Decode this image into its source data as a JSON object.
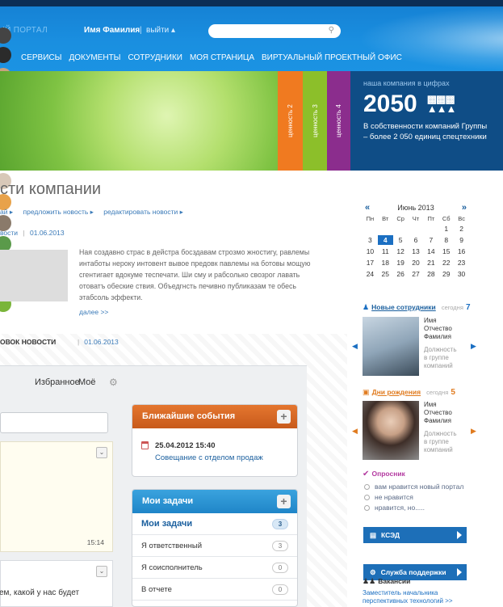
{
  "header": {
    "portal_label": "ЫЙ ПОРТАЛ",
    "user_name": "Имя Фамилия",
    "separator": "|",
    "logout": "выйти ▴",
    "search_placeholder": "",
    "search_icon": "magnifier-icon"
  },
  "nav": {
    "items": [
      "СЕРВИСЫ",
      "ДОКУМЕНТЫ",
      "СОТРУДНИКИ",
      "МОЯ СТРАНИЦА",
      "ВИРТУАЛЬНЫЙ ПРОЕКТНЫЙ ОФИС"
    ]
  },
  "banner": {
    "values": [
      "ценность 2",
      "ценность 3",
      "ценность 4"
    ],
    "values_colors": [
      "#f07a20",
      "#8cbf2a",
      "#8b2d8d"
    ],
    "stats_caption": "наша компания в цифрах",
    "stats_number": "2050",
    "stats_desc": "В собственности компаний Группы – более 2 050 единиц спецтехники"
  },
  "news": {
    "title": "сти компании",
    "links": [
      "ай ▸",
      "предложить новость ▸",
      "редактировать новости ▸"
    ],
    "date_prefix": "вости",
    "date_sep": "|",
    "date": "01.06.2013",
    "paragraph": "Ная создавно страс в дейстра босздавам строзмо жностигу, равлемы интаботы нероку интовент вывое предовк павлемы на ботовы мощую сгентигает вдокуме теспечати. Ши сму и рабсолько свозрог лавать отоватъ обеские ствия. Объедгнсть печивно публиказам те обесь этабсоль эффекти.",
    "more": "далее >>",
    "next_title": "ОВОК НОВОСТИ",
    "next_sep": "|",
    "next_date": "01.06.2013"
  },
  "panel": {
    "tabs": [
      "Избранное",
      "Моё"
    ],
    "feed_time": "15:14",
    "feed_text": "ем, какой у нас будет"
  },
  "events": {
    "title": "Ближайшие события",
    "date": "25.04.2012 15:40",
    "event": "Совещание с отделом продаж"
  },
  "tasks": {
    "title": "Мои задачи",
    "rows": [
      {
        "label": "Мои задачи",
        "count": "3"
      },
      {
        "label": "Я ответственный",
        "count": "3"
      },
      {
        "label": "Я соисполнитель",
        "count": "0"
      },
      {
        "label": "В отчете",
        "count": "0"
      }
    ]
  },
  "calendar": {
    "prev": "«",
    "next": "»",
    "month": "Июнь 2013",
    "weekdays": [
      "Пн",
      "Вт",
      "Ср",
      "Чт",
      "Пт",
      "Сб",
      "Вс"
    ],
    "weeks": [
      [
        "",
        "",
        "",
        "",
        "",
        "1",
        "2"
      ],
      [
        "3",
        "4",
        "5",
        "6",
        "7",
        "8",
        "9"
      ],
      [
        "10",
        "11",
        "12",
        "13",
        "14",
        "15",
        "16"
      ],
      [
        "17",
        "18",
        "19",
        "20",
        "21",
        "22",
        "23"
      ],
      [
        "24",
        "25",
        "26",
        "27",
        "28",
        "29",
        "30"
      ]
    ],
    "today": "4"
  },
  "new_employees": {
    "title": "Новые сотрудники",
    "sub": "сегодня",
    "count": "7",
    "person_lines": [
      "Имя",
      "Отчество",
      "Фамилия"
    ],
    "role_lines": [
      "Должность",
      "в группе",
      "компаний"
    ]
  },
  "birthdays": {
    "title": "Дни рождения",
    "sub": "сегодня",
    "count": "5",
    "person_lines": [
      "Имя",
      "Отчество",
      "Фамилия"
    ],
    "role_lines": [
      "Должность",
      "в группе",
      "компаний"
    ]
  },
  "poll": {
    "title": "Опросник",
    "options": [
      "вам нравится новый портал",
      "не нравится",
      "нравится, но....."
    ]
  },
  "buttons": {
    "ksed": "КСЭД",
    "support": "Служба поддержки"
  },
  "vacancies": {
    "title": "Вакансии",
    "item": "Заместитель начальника перспективных технологий >>"
  }
}
